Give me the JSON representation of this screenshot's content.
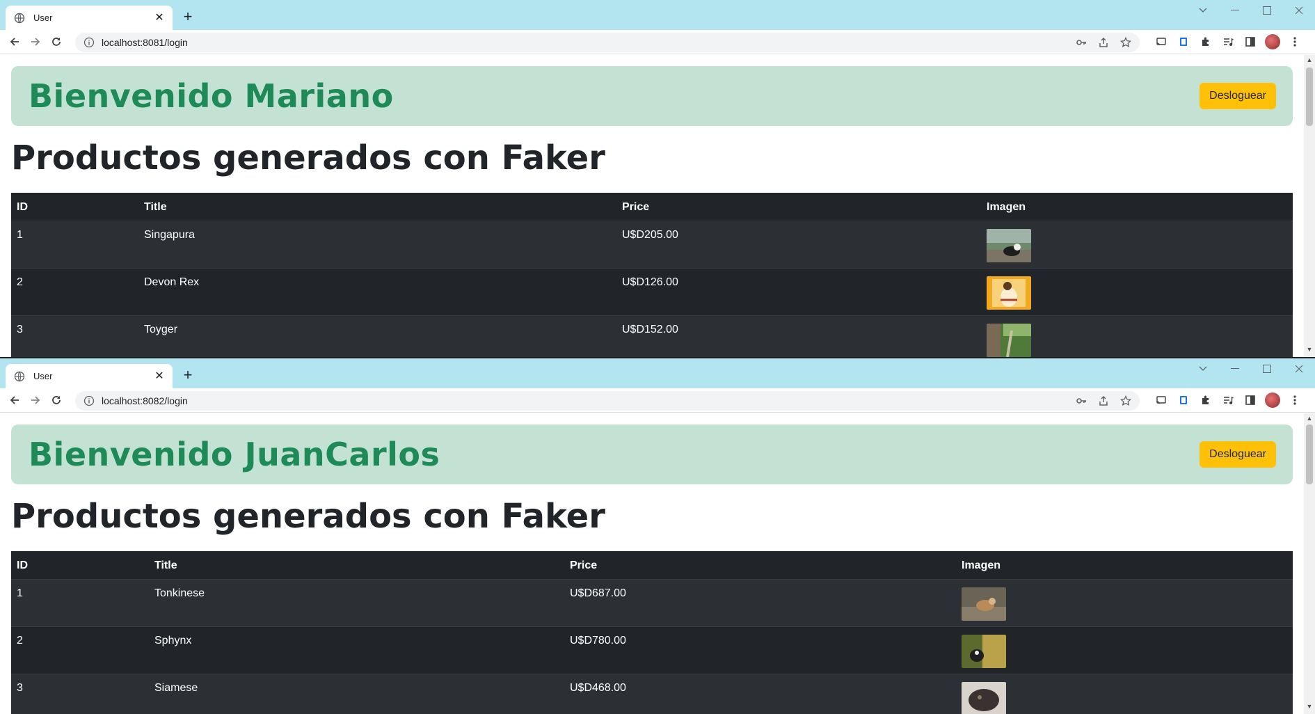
{
  "windows": [
    {
      "tab_title": "User",
      "url": "localhost:8081/login",
      "welcome_text": "Bienvenido Mariano",
      "logout_label": "Desloguear",
      "heading": "Productos generados con Faker",
      "table": {
        "headers": [
          "ID",
          "Title",
          "Price",
          "Imagen"
        ],
        "rows": [
          {
            "id": "1",
            "title": "Singapura",
            "price": "U$D205.00",
            "image": "cat-photo-outdoor"
          },
          {
            "id": "2",
            "title": "Devon Rex",
            "price": "U$D126.00",
            "image": "cat-illustration-yellow"
          },
          {
            "id": "3",
            "title": "Toyger",
            "price": "U$D152.00",
            "image": "cat-photo-garden"
          }
        ]
      }
    },
    {
      "tab_title": "User",
      "url": "localhost:8082/login",
      "welcome_text": "Bienvenido JuanCarlos",
      "logout_label": "Desloguear",
      "heading": "Productos generados con Faker",
      "table": {
        "headers": [
          "ID",
          "Title",
          "Price",
          "Imagen"
        ],
        "rows": [
          {
            "id": "1",
            "title": "Tonkinese",
            "price": "U$D687.00",
            "image": "cat-photo-ground"
          },
          {
            "id": "2",
            "title": "Sphynx",
            "price": "U$D780.00",
            "image": "cat-photo-leaves"
          },
          {
            "id": "3",
            "title": "Siamese",
            "price": "U$D468.00",
            "image": "cat-photo-closeup"
          }
        ]
      }
    }
  ],
  "colors": {
    "tabstrip": "#b3e5f0",
    "welcome_bg": "#c4e2d4",
    "welcome_text": "#1d8a57",
    "logout_button": "#ffc107",
    "table_bg": "#212529"
  }
}
